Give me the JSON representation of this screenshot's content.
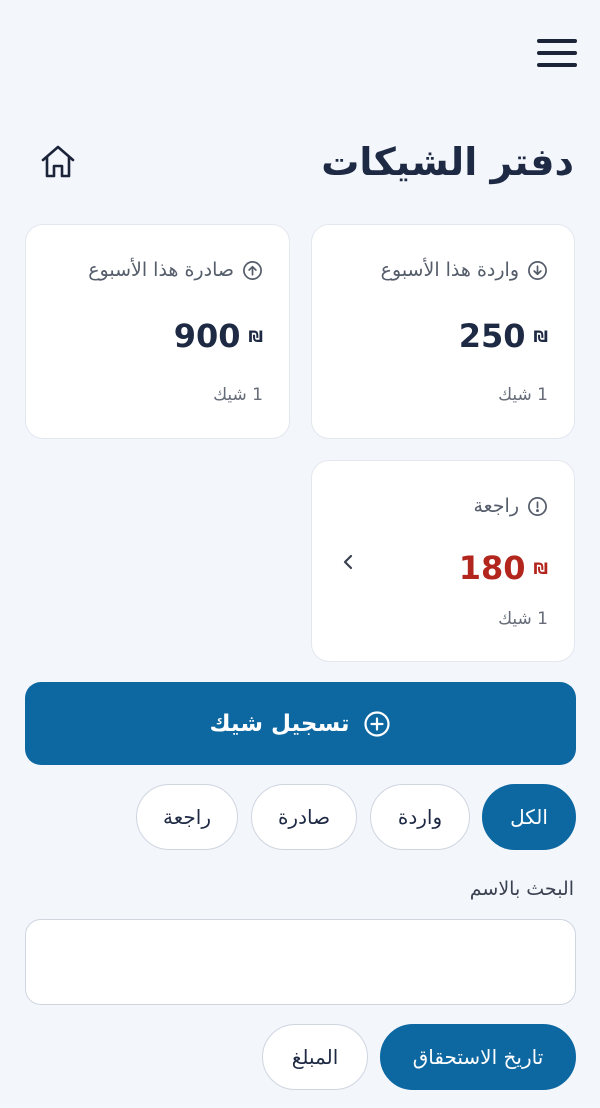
{
  "header": {
    "title": "دفتر الشيكات",
    "menu_icon": "hamburger-menu-icon",
    "home_icon": "home-icon"
  },
  "cards": {
    "incoming": {
      "label": "واردة هذا الأسبوع",
      "icon": "arrow-down-circle-icon",
      "amount": "250",
      "currency": "₪",
      "count": "1 شيك"
    },
    "outgoing": {
      "label": "صادرة هذا الأسبوع",
      "icon": "arrow-up-circle-icon",
      "amount": "900",
      "currency": "₪",
      "count": "1 شيك"
    },
    "returned": {
      "label": "راجعة",
      "icon": "exclamation-circle-icon",
      "amount": "180",
      "currency": "₪",
      "count": "1 شيك",
      "amount_color": "#b3261e"
    }
  },
  "register_button": {
    "label": "تسجيل شيك",
    "icon": "plus-circle-icon"
  },
  "filters": {
    "all": "الكل",
    "incoming": "واردة",
    "outgoing": "صادرة",
    "returned": "راجعة",
    "active": "all"
  },
  "search": {
    "label": "البحث بالاسم",
    "value": "",
    "placeholder": ""
  },
  "sort": {
    "due_date": "تاريخ الاستحقاق",
    "amount": "المبلغ",
    "active": "due_date"
  },
  "colors": {
    "primary": "#0d68a2",
    "returned_amount": "#b3261e",
    "background": "#f3f6fb"
  }
}
